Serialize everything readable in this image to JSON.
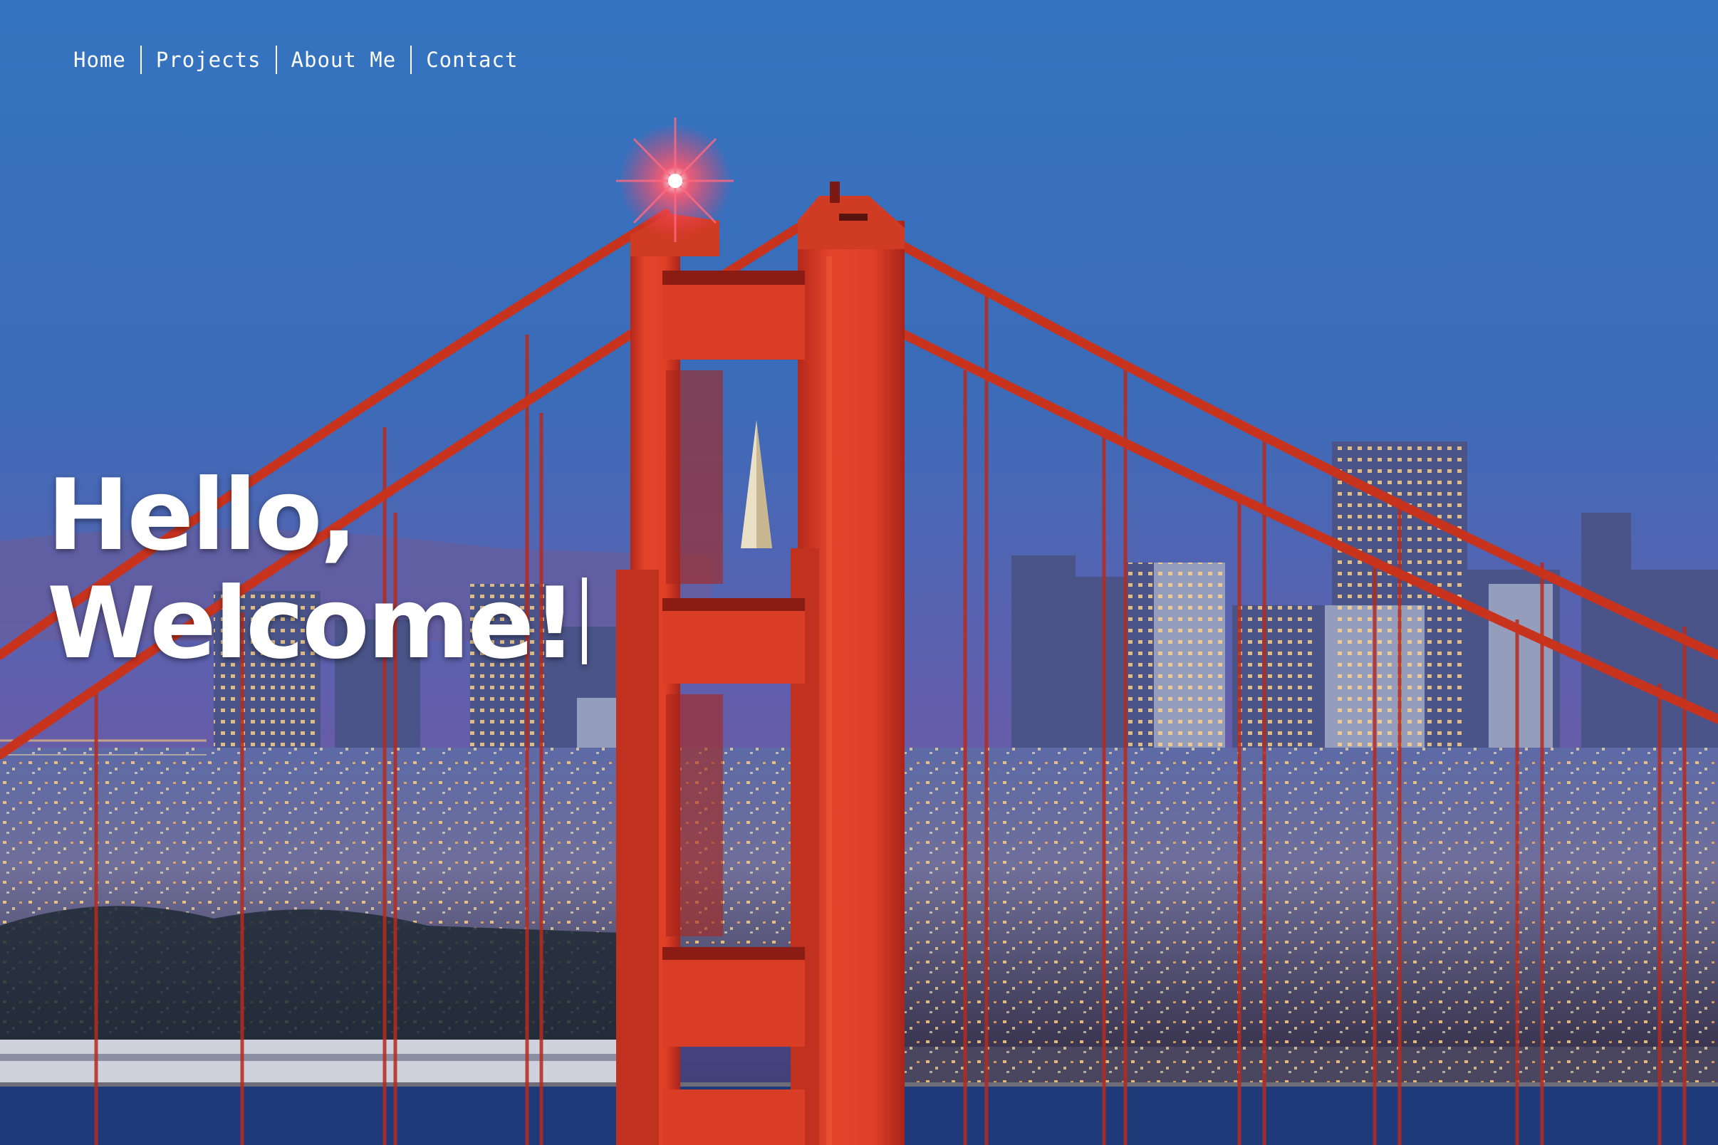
{
  "nav": {
    "items": [
      {
        "label": "Home"
      },
      {
        "label": "Projects"
      },
      {
        "label": "About Me"
      },
      {
        "label": "Contact"
      }
    ]
  },
  "hero": {
    "line1": "Hello,",
    "line2": "Welcome!",
    "background": "golden-gate-bridge-san-francisco-night-photo"
  },
  "colors": {
    "sky_top": "#2f6fba",
    "sky_mid": "#4664b4",
    "bridge": "#d8381e",
    "cable": "#c2301c",
    "text": "#ffffff"
  }
}
